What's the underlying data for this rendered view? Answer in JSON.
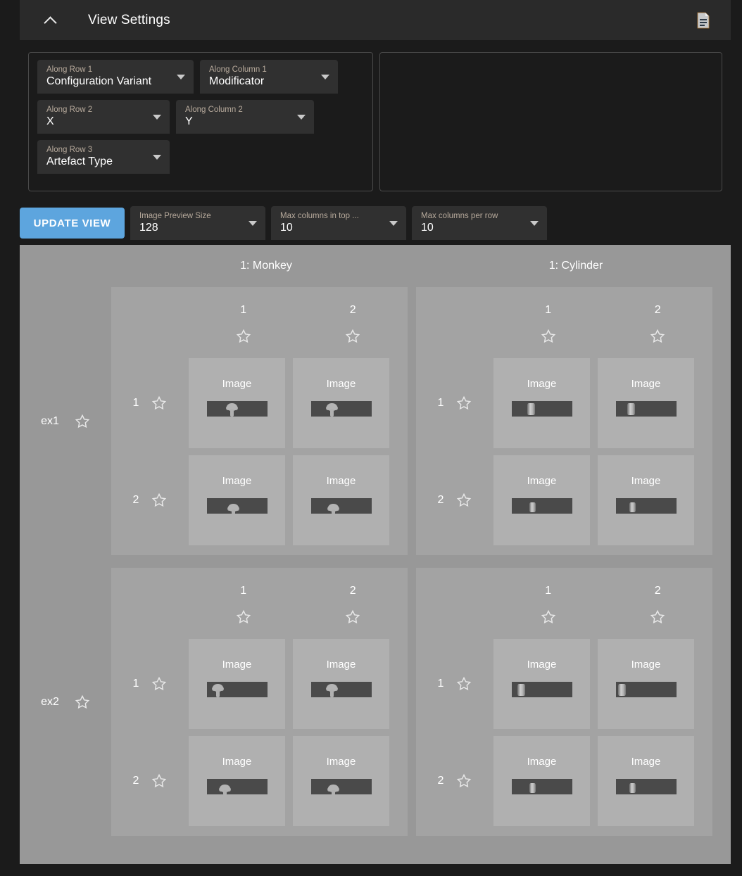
{
  "header": {
    "title": "View Settings",
    "collapse_icon": "chevron-up-icon",
    "doc_icon": "document-icon"
  },
  "settings": {
    "selects": [
      {
        "label": "Along Row 1",
        "value": "Configuration Variant",
        "name": "along-row-1"
      },
      {
        "label": "Along Column 1",
        "value": "Modificator",
        "name": "along-column-1"
      },
      {
        "label": "Along Row 2",
        "value": "X",
        "name": "along-row-2"
      },
      {
        "label": "Along Column 2",
        "value": "Y",
        "name": "along-column-2"
      },
      {
        "label": "Along Row 3",
        "value": "Artefact Type",
        "name": "along-row-3"
      }
    ]
  },
  "toolbar": {
    "update_label": "UPDATE VIEW",
    "accent_color": "#5da5de",
    "selects": [
      {
        "label": "Image Preview Size",
        "value": "128"
      },
      {
        "label": "Max columns in top ...",
        "value": "10"
      },
      {
        "label": "Max columns per row",
        "value": "10"
      }
    ]
  },
  "viewer": {
    "top_columns": [
      "1: Monkey",
      "1: Cylinder"
    ],
    "row_labels": [
      "ex1",
      "ex2"
    ],
    "image_label": "Image",
    "star_icon": "star-outline-icon",
    "groups": [
      {
        "column_headers": [
          "1",
          "2"
        ],
        "row_headers": [
          "1",
          "2"
        ],
        "shape": "monkey"
      },
      {
        "column_headers": [
          "1",
          "2"
        ],
        "row_headers": [
          "1",
          "2"
        ],
        "shape": "cylinder"
      }
    ],
    "colors": {
      "viewer_bg": "#989898",
      "group_bg": "#a3a3a3",
      "card_bg": "#b0b0b0",
      "thumb_bg": "#4a4a4a"
    }
  }
}
